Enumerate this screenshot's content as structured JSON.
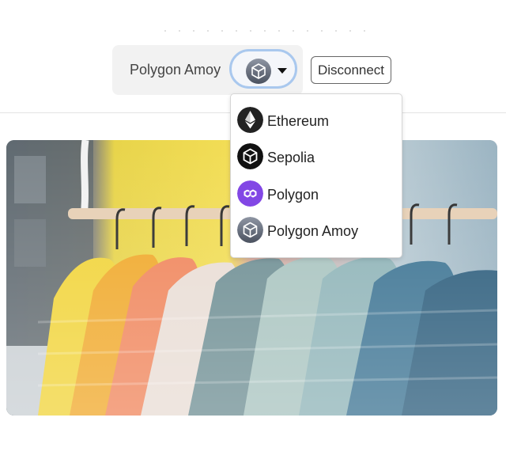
{
  "header": {
    "network_label": "Polygon Amoy",
    "selected_network_icon": "polygon-amoy-cube-icon",
    "disconnect_label": "Disconnect"
  },
  "network_dropdown": {
    "options": [
      {
        "label": "Ethereum",
        "icon": "ethereum-icon",
        "color": "#222222"
      },
      {
        "label": "Sepolia",
        "icon": "sepolia-cube-icon",
        "color": "#111111"
      },
      {
        "label": "Polygon",
        "icon": "polygon-icon",
        "color": "#8247e5"
      },
      {
        "label": "Polygon Amoy",
        "icon": "polygon-amoy-cube-icon",
        "color": "#6b7280"
      }
    ]
  },
  "hero": {
    "image": "clothing-rack-puffer-jackets-photo"
  },
  "colors": {
    "focus_ring": "#a9c8ee",
    "bar_bg": "#f2f2f2"
  }
}
